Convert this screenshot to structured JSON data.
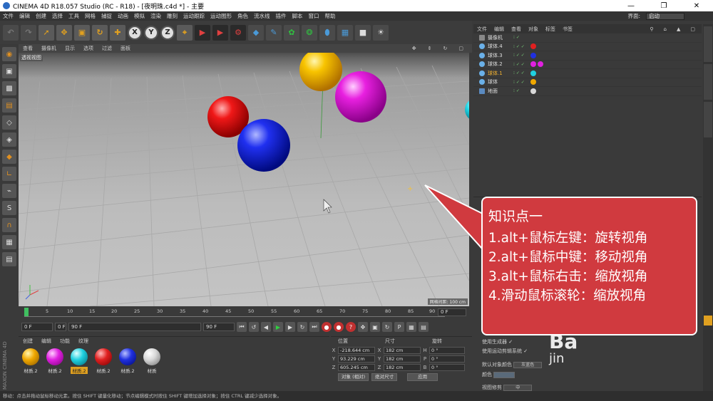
{
  "window": {
    "title": "CINEMA 4D R18.057 Studio (RC - R18) - [夜明珠.c4d *] - 主要",
    "controls": [
      "—",
      "❐",
      "✕"
    ]
  },
  "menubar": {
    "items": [
      "文件",
      "编辑",
      "创建",
      "选择",
      "工具",
      "网格",
      "捕捉",
      "动画",
      "模拟",
      "渲染",
      "雕刻",
      "运动跟踪",
      "运动图形",
      "角色",
      "流水线",
      "插件",
      "脚本",
      "窗口",
      "帮助"
    ],
    "layout_label": "界面:",
    "layout_value": "启动"
  },
  "toolbar": {
    "xyz": [
      "X",
      "Y",
      "Z"
    ]
  },
  "viewport": {
    "menu": [
      "查看",
      "摄像机",
      "显示",
      "选项",
      "过滤",
      "面板"
    ],
    "label": "透视视图",
    "scale": "网格间距: 100 cm"
  },
  "timeline": {
    "ticks": [
      "0",
      "5",
      "10",
      "15",
      "20",
      "25",
      "30",
      "35",
      "40",
      "45",
      "50",
      "55",
      "60",
      "65",
      "70",
      "75",
      "80",
      "85",
      "90"
    ],
    "current_frame": "0 F"
  },
  "transport": {
    "start": "0 F",
    "min": "0 F",
    "max": "90 F",
    "end": "90 F"
  },
  "materials": {
    "menu": [
      "创建",
      "编辑",
      "功能",
      "纹理"
    ],
    "items": [
      {
        "label": "材质.2",
        "color": "#f0a800",
        "active": false
      },
      {
        "label": "材质.2",
        "color": "#e020e0",
        "active": false
      },
      {
        "label": "材质.2",
        "color": "#20d0e0",
        "active": true
      },
      {
        "label": "材质.2",
        "color": "#e02020",
        "active": false
      },
      {
        "label": "材质.2",
        "color": "#2030e0",
        "active": false
      },
      {
        "label": "材质",
        "color": "#d8d8d8",
        "active": false
      }
    ]
  },
  "brand": "MAXON CINEMA 4D",
  "coordinates": {
    "headers": [
      "位置",
      "尺寸",
      "旋转"
    ],
    "rows": [
      {
        "axis": "X",
        "pos": "-218.644 cm",
        "size_axis": "X",
        "size": "182 cm",
        "rot_axis": "H",
        "rot": "0 °"
      },
      {
        "axis": "Y",
        "pos": "93.229 cm",
        "size_axis": "Y",
        "size": "182 cm",
        "rot_axis": "P",
        "rot": "0 °"
      },
      {
        "axis": "Z",
        "pos": "605.245 cm",
        "size_axis": "Z",
        "size": "182 cm",
        "rot_axis": "B",
        "rot": "0 °"
      }
    ],
    "mode": "对象 (相对)",
    "size_mode": "绝对尺寸",
    "apply": "应用"
  },
  "objects": {
    "menu": [
      "文件",
      "编辑",
      "查看",
      "对象",
      "标签",
      "书签"
    ],
    "rows": [
      {
        "name": "摄像机",
        "icon": "camera-icon",
        "selected": false,
        "tags": []
      },
      {
        "name": "球体.4",
        "icon": "sphere-icon",
        "selected": false,
        "tags": [
          "#e02020"
        ]
      },
      {
        "name": "球体.3",
        "icon": "sphere-icon",
        "selected": false,
        "tags": [
          "#2030e0"
        ]
      },
      {
        "name": "球体.2",
        "icon": "sphere-icon",
        "selected": false,
        "tags": [
          "#e020e0",
          "#e020e0"
        ]
      },
      {
        "name": "球体.1",
        "icon": "sphere-icon",
        "selected": true,
        "tags": [
          "#20d0e0"
        ]
      },
      {
        "name": "球体",
        "icon": "sphere-icon",
        "selected": false,
        "tags": [
          "#f0a800"
        ]
      },
      {
        "name": "地面",
        "icon": "floor-icon",
        "selected": false,
        "tags": [
          "#d8d8d8"
        ]
      }
    ]
  },
  "attributes": {
    "use_generator": "使用生成器",
    "use_motion_clip": "使用运动剪辑系统",
    "default_color_label": "默认对象颜色",
    "default_color_value": "灰蓝色",
    "color_label": "颜色",
    "view_clip_label": "视图修剪",
    "view_clip_value": "中"
  },
  "callout": {
    "title": "知识点一",
    "lines": [
      "1.alt+鼠标左键：旋转视角",
      "2.alt+鼠标中键：移动视角",
      "3.alt+鼠标右击：缩放视角",
      "4.滑动鼠标滚轮：缩放视角"
    ],
    "fill": "#d03a3f"
  },
  "watermark": {
    "main": "Ba",
    "sub": "jin"
  },
  "statusbar": "移动：点击并拖动鼠标移动元素。按住 SHIFT 键量化移动；节点编辑模式时按住 SHIFT 键增加选择对象；按住 CTRL 键减少选择对象。"
}
